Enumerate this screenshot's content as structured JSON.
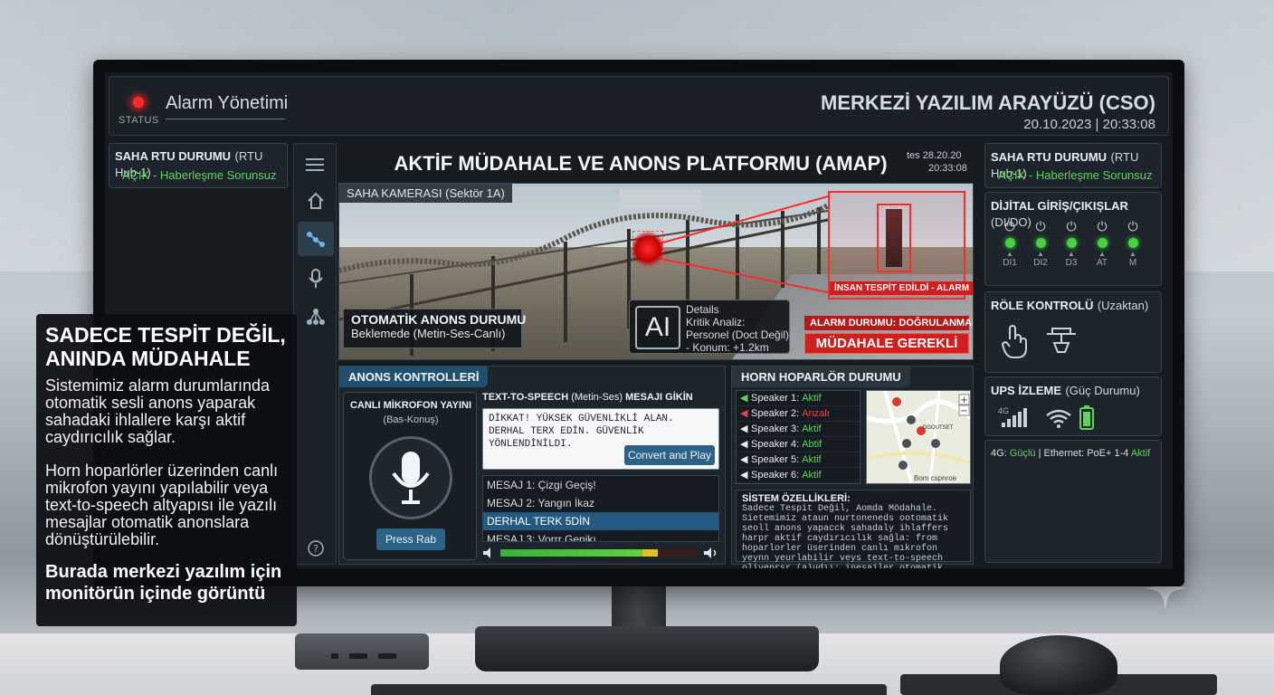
{
  "header": {
    "status_label": "STATUS",
    "app_title": "Alarm Yönetimi",
    "system_title": "MERKEZİ YAZILIM ARAYÜZÜ (CSO)",
    "datetime": "20.10.2023 | 20:33:08"
  },
  "rtu_left": {
    "title": "SAHA RTU DURUMU",
    "subtitle": "(RTU Hub-1)",
    "status": "AÇIK - Haberleşme Sorunsuz"
  },
  "main": {
    "title": "AKTİF MÜDAHALE VE ANONS PLATFORMU (AMAP)",
    "time_line1": "tes  28.20.20",
    "time_line2": "20:33:08"
  },
  "nav_icons": [
    "menu-icon",
    "home-icon",
    "network-icon",
    "microphone-icon",
    "topology-icon",
    "help-icon"
  ],
  "camera": {
    "label": "SAHA KAMERASI",
    "label_sub": "(Sektör 1A)",
    "detect_label": "İNSAN TESPİT EDİLDİ - ALARM",
    "auto_title": "OTOMATİK ANONS DURUMU",
    "auto_value": "Beklemede (Metin-Ses-Canlı)",
    "ai_logo": "AI",
    "ai_lines": [
      "Details",
      "Kritik Analiz:",
      "Personel (Doct Değil)",
      "- Konum: +1.2km"
    ],
    "alarm_status": "ALARM DURUMU: DOĞRULANMADI",
    "action_required": "MÜDAHALE GEREKLİ"
  },
  "anons": {
    "tab": "ANONS KONTROLLERİ",
    "mic_title": "CANLI MİKROFON YAYINI",
    "mic_sub": "(Bas-Konuş)",
    "mic_button": "Press Rab",
    "tts_title": "TEXT-TO-SPEECH",
    "tts_title_mid": "(Metin-Ses)",
    "tts_title_end": "MESAJI GİKİN",
    "tts_text": "DİKKAT! YÜKSEK GÜVENLİKLİ ALAN. DERHAL TERX EDİN. GÜVENLİK YÖNLENDİNİLDI.",
    "tts_button": "Convert and Play",
    "messages": [
      "MESAJ 1: Çizgi Geçiş!",
      "MESAJ 2: Yangın İkaz",
      "DERHAL TERK 5DİN",
      "MESAJ 3: Vorrr Genikı"
    ],
    "selected_index": 2,
    "volume_level": 0.72,
    "volume_peak": 0.08
  },
  "horn": {
    "tab": "HORN HOPARLÖR DURUMU",
    "speakers": [
      {
        "name": "Speaker 1:",
        "state": "Aktif",
        "color": "#5fd35c",
        "icon": "speaker-green-icon"
      },
      {
        "name": "Speaker 2:",
        "state": "Anzalı",
        "color": "#e24848",
        "icon": "speaker-red-icon"
      },
      {
        "name": "Speaker 3:",
        "state": "Aktif",
        "color": "#5fd35c",
        "icon": "speaker-icon"
      },
      {
        "name": "Speaker 4:",
        "state": "Abtif",
        "color": "#5fd35c",
        "icon": "speaker-icon"
      },
      {
        "name": "Speaker 5:",
        "state": "Aktif",
        "color": "#5fd35c",
        "icon": "speaker-icon"
      },
      {
        "name": "Speaker 6:",
        "state": "Aktif",
        "color": "#5fd35c",
        "icon": "speaker-icon"
      }
    ],
    "map_label": "Bom cspnroe",
    "map_place": "DGOUTSET",
    "sys_title": "SİSTEM ÖZELLİKLERİ:",
    "sys_text": "Sadece Tespit Değil, Aomda Mödahale. Sietemimiz ataun nurtoneneds ootomatik seoll anons yapacck sahadaly ihlaffers harpr aktif caydırıcılık sağla: from hoparlorler üserinden canlı mıkrofon yeynn yeurlabilir veys text-to-speech oliyeprsr (a)udıı: inesajler otomatik anonlara dönüştürülebilir."
  },
  "rtu_right": {
    "title": "SAHA RTU DURUMU",
    "subtitle": "(RTU Hub-1)",
    "status": "AÇIK - Haberleşme Sorunsuz"
  },
  "dio": {
    "title": "DİJİTAL GİRİŞ/ÇIKIŞLAR",
    "subtitle": "(DI/DO)",
    "channels": [
      "DI1",
      "DI2",
      "D3",
      "AT",
      "M"
    ]
  },
  "relay": {
    "title": "RÖLE KONTROLÜ",
    "subtitle": "(Uzaktan)"
  },
  "ups": {
    "title": "UPS İZLEME",
    "subtitle": "(Güç Durumu)",
    "signal_label": "4G"
  },
  "network": {
    "prefix": "4G:",
    "g4": "Güçlü",
    "mid": "| Ethernet: PoE+ 1-4",
    "eth": "Aktif"
  },
  "overlay": {
    "heading": "SADECE TESPİT DEĞİL,\nANINDA MÜDAHALE",
    "p1": "Sistemimiz alarm durumlarında otomatik sesli anons yaparak sahadaki ihlallere karşı aktif caydırıcılık sağlar.",
    "p2": "Horn hoparlörler üzerinden canlı mikrofon yayını yapılabilir veya text-to-speech altyapısı ile yazılı mesajlar otomatik anonslara dönüştürülebilir.",
    "footer": "Burada merkezi yazılım için monitörün içinde görüntü"
  },
  "colors": {
    "accent": "#2b6286",
    "ok": "#5fd35c",
    "alarm": "#d01f1f"
  }
}
